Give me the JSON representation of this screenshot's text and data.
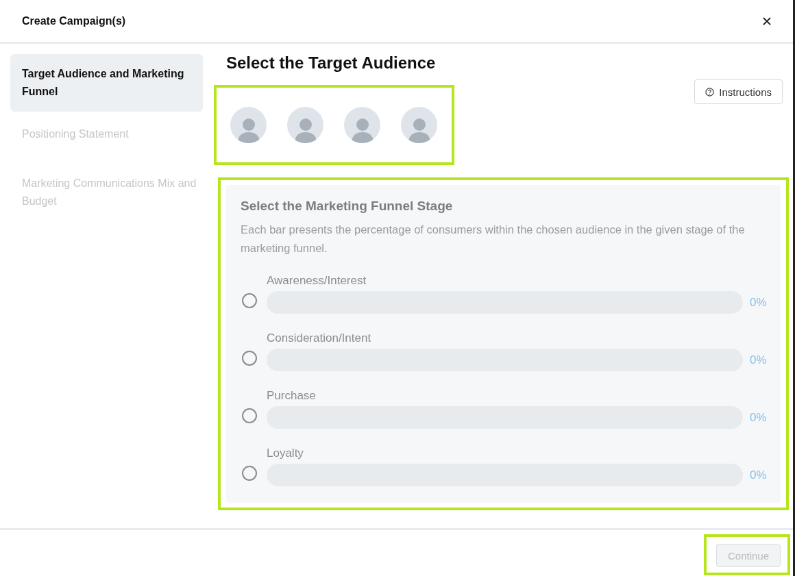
{
  "window": {
    "title": "Create Campaign(s)"
  },
  "sidebar": {
    "items": [
      {
        "label": "Target Audience and Marketing Funnel",
        "selected": true
      },
      {
        "label": "Positioning Statement",
        "selected": false
      },
      {
        "label": "Marketing Communications Mix and Budget",
        "selected": false
      }
    ]
  },
  "main": {
    "title": "Select the Target Audience",
    "instructions_button": "Instructions",
    "avatars": [
      {
        "selected": false
      },
      {
        "selected": false
      },
      {
        "selected": false
      },
      {
        "selected": false
      }
    ],
    "funnel": {
      "title": "Select the Marketing Funnel Stage",
      "description": "Each bar presents the percentage of consumers within the chosen audience in the given stage of the marketing funnel.",
      "stages": [
        {
          "label": "Awareness/Interest",
          "selected": false,
          "reading": "0%"
        },
        {
          "label": "Consideration/Intent",
          "selected": false,
          "reading": "0%"
        },
        {
          "label": "Purchase",
          "selected": false,
          "reading": "0%"
        },
        {
          "label": "Loyalty",
          "selected": false,
          "reading": "0%"
        }
      ]
    }
  },
  "footer": {
    "continue": {
      "label": "Continue",
      "disabled": true
    }
  }
}
